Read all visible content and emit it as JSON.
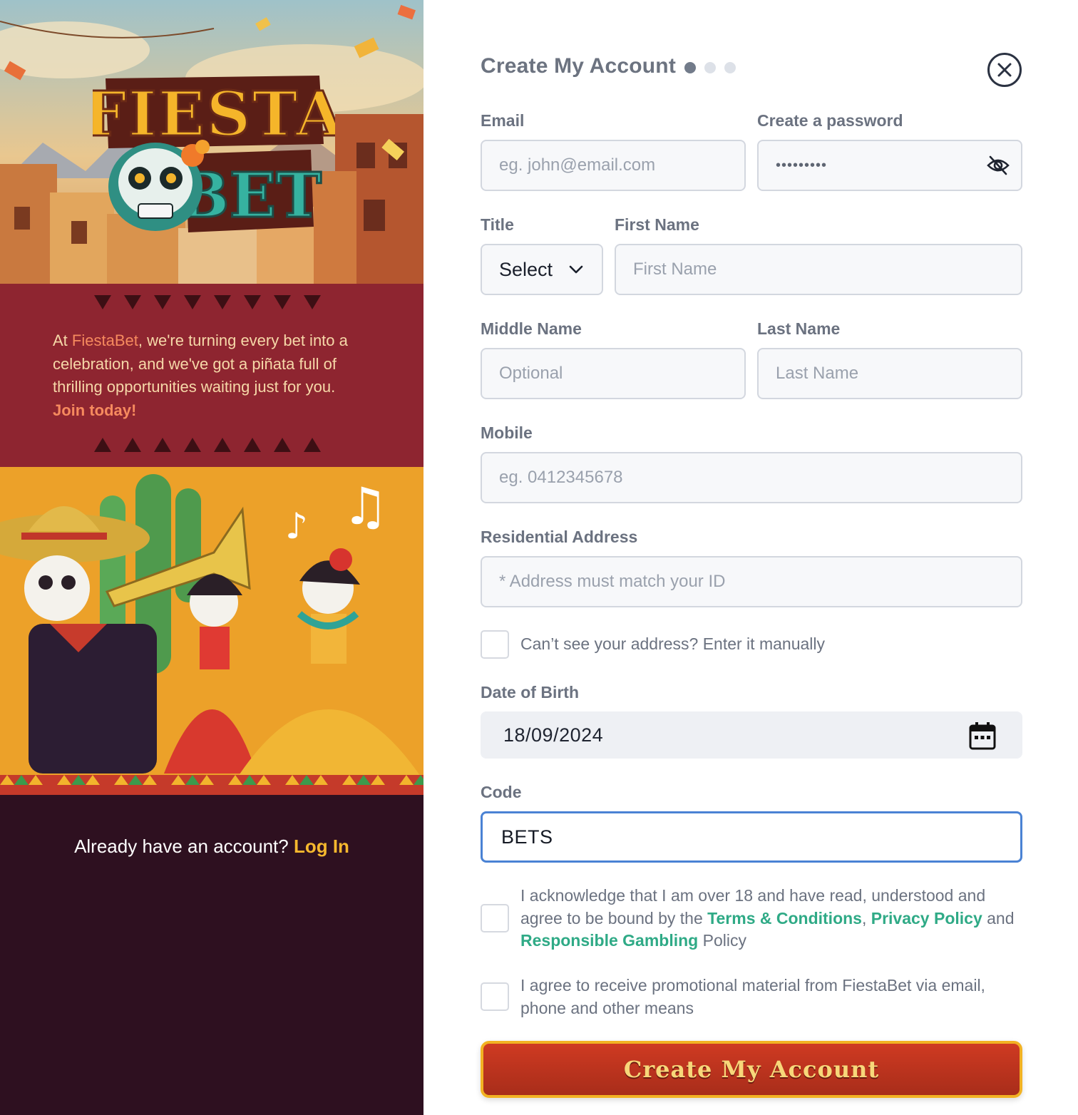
{
  "left_panel": {
    "logo": {
      "line1": "FIESTA",
      "line2": "BET"
    },
    "tagline": {
      "prefix": "At ",
      "brand": "FiestaBet",
      "body": ", we're turning every bet into a celebration, and we've got a piñata full of thrilling opportunities waiting just for you. ",
      "cta": "Join today!"
    },
    "login": {
      "prompt": "Already have an account?",
      "link": "Log In"
    }
  },
  "form": {
    "title": "Create My Account",
    "steps": {
      "total": 3,
      "current": 1
    },
    "email": {
      "label": "Email",
      "placeholder": "eg. john@email.com"
    },
    "password": {
      "label": "Create a password",
      "value": "•••••••••"
    },
    "title_field": {
      "label": "Title",
      "value": "Select"
    },
    "first_name": {
      "label": "First Name",
      "placeholder": "First Name"
    },
    "middle_name": {
      "label": "Middle Name",
      "placeholder": "Optional"
    },
    "last_name": {
      "label": "Last Name",
      "placeholder": "Last Name"
    },
    "mobile": {
      "label": "Mobile",
      "placeholder": "eg. 0412345678"
    },
    "address": {
      "label": "Residential Address",
      "placeholder": "* Address must match your ID"
    },
    "manual_address": {
      "label": "Can’t see your address? Enter it manually"
    },
    "dob": {
      "label": "Date of Birth",
      "value": "18/09/2024"
    },
    "code": {
      "label": "Code",
      "value": "BETS"
    },
    "terms": {
      "text1": "I acknowledge that I am over 18 and have read, understood and agree to be bound by the ",
      "link1": "Terms & Conditions",
      "sep": ", ",
      "link2": "Privacy Policy",
      "and": " and ",
      "link3": "Responsible Gambling",
      "text2": " Policy"
    },
    "promo": {
      "text": "I agree to receive promotional material from FiestaBet via email, phone and other means"
    },
    "submit_label": "Create My Account"
  },
  "colors": {
    "accent_link": "#2faa86",
    "focus_border": "#4a82d4",
    "submit_bg": "#c1351f",
    "submit_border": "#f2b223",
    "login_link": "#f5b82e",
    "band": "#8e2530"
  },
  "icons": [
    "close-icon",
    "eye-off-icon",
    "chevron-down-icon",
    "calendar-icon"
  ]
}
